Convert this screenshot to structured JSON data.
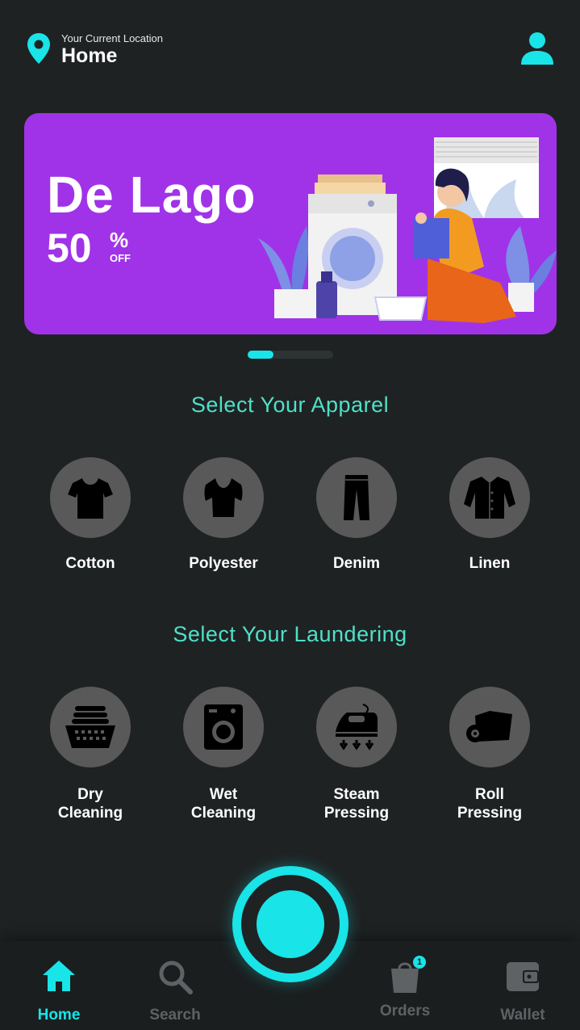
{
  "header": {
    "location_caption": "Your Current Location",
    "location_title": "Home",
    "icons": {
      "location": "map-pin-icon",
      "profile": "user-icon"
    }
  },
  "banner": {
    "brand": "De Lago",
    "discount_number": "50",
    "discount_symbol": "%",
    "discount_suffix": "OFF",
    "background": "#a033e8",
    "carousel": {
      "pages": 2,
      "active": 1
    }
  },
  "apparel": {
    "title": "Select Your Apparel",
    "items": [
      {
        "label": "Cotton",
        "icon": "tshirt-icon"
      },
      {
        "label": "Polyester",
        "icon": "blouse-icon"
      },
      {
        "label": "Denim",
        "icon": "pants-icon"
      },
      {
        "label": "Linen",
        "icon": "shirt-icon"
      }
    ]
  },
  "laundering": {
    "title": "Select Your Laundering",
    "items": [
      {
        "line1": "Dry",
        "line2": "Cleaning",
        "icon": "laundry-basket-icon"
      },
      {
        "line1": "Wet",
        "line2": "Cleaning",
        "icon": "washing-machine-icon"
      },
      {
        "line1": "Steam",
        "line2": "Pressing",
        "icon": "steam-iron-icon"
      },
      {
        "line1": "Roll",
        "line2": "Pressing",
        "icon": "fabric-roll-icon"
      }
    ]
  },
  "nav": {
    "items": [
      {
        "label": "Home",
        "icon": "home-icon",
        "active": true
      },
      {
        "label": "Search",
        "icon": "search-icon",
        "active": false
      },
      {
        "label": "Orders",
        "icon": "shopping-bag-icon",
        "active": false,
        "badge": "1"
      },
      {
        "label": "Wallet",
        "icon": "wallet-icon",
        "active": false
      }
    ],
    "center_button_icon": "record-button-icon"
  },
  "colors": {
    "accent": "#19e4e8",
    "section_title": "#4fe0c8",
    "background": "#1f2223",
    "tile": "#595959",
    "nav_inactive": "#5e6264"
  }
}
